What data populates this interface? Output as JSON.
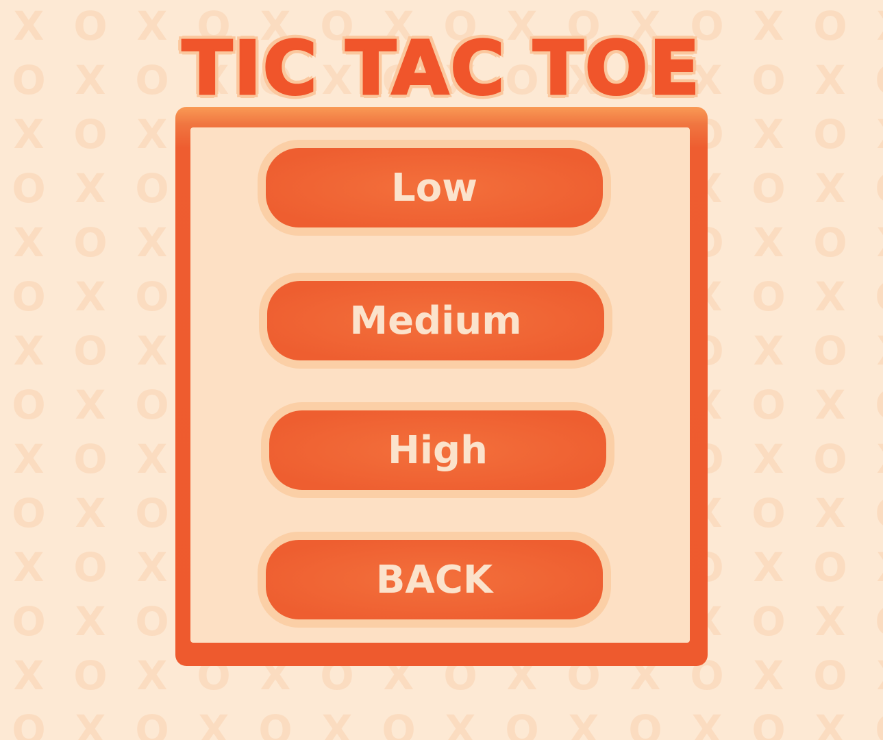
{
  "title": "TIC TAC TOE",
  "background": {
    "glyphs": [
      "X",
      "O"
    ],
    "color": "#fbdcc0"
  },
  "menu": {
    "buttons": [
      {
        "id": "low",
        "label": "Low"
      },
      {
        "id": "medium",
        "label": "Medium"
      },
      {
        "id": "high",
        "label": "High"
      },
      {
        "id": "back",
        "label": "BACK"
      }
    ]
  },
  "colors": {
    "accent": "#ee5a2e",
    "button_outline": "#fbcfa6",
    "panel_fill": "#fde0c4",
    "page_background": "#fde9d4",
    "button_text": "#fbe3cc"
  }
}
